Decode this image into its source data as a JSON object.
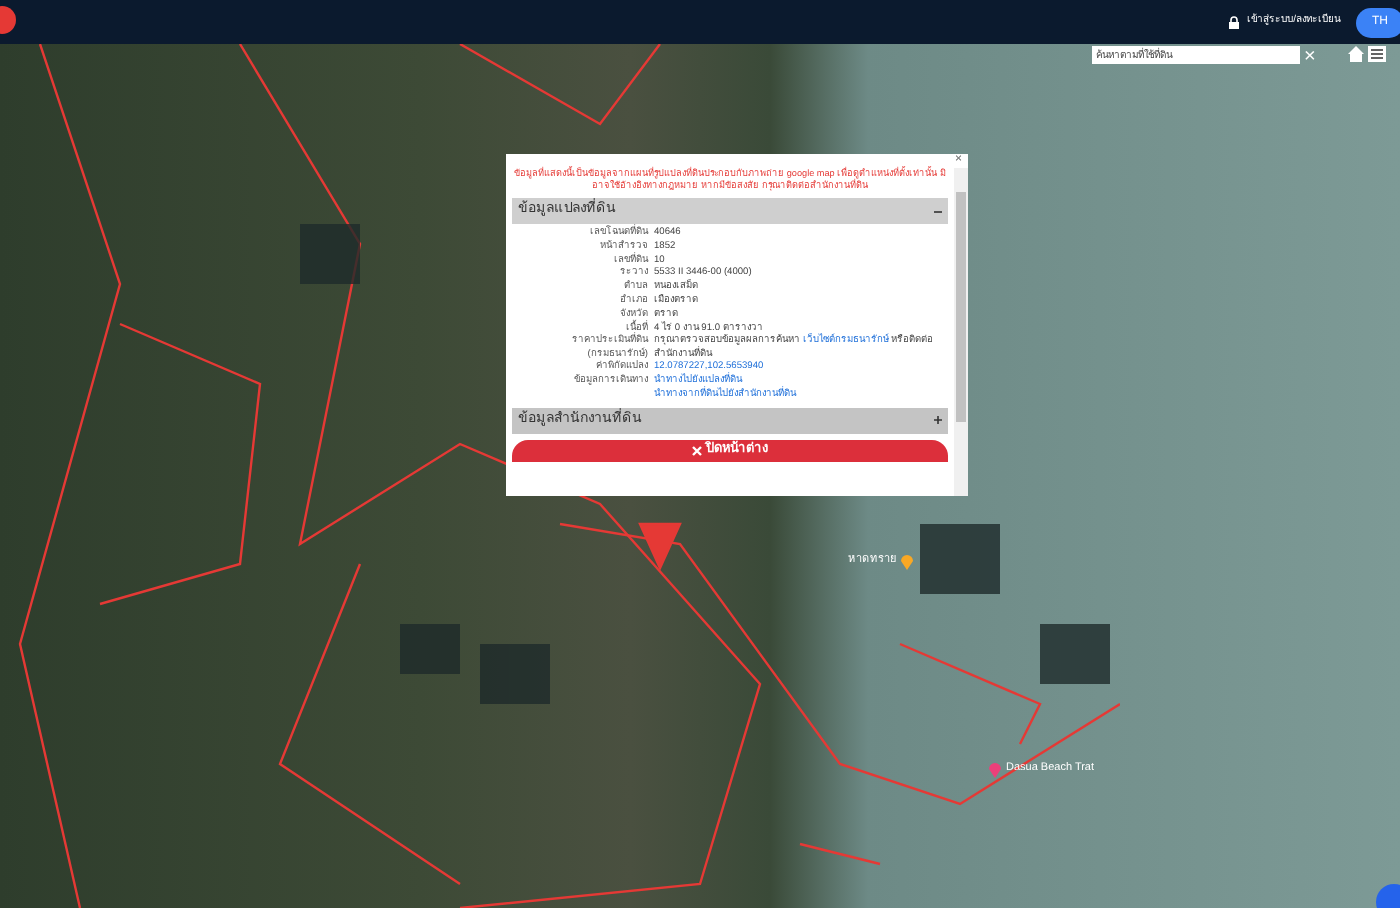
{
  "top_bar": {
    "login_link": "เข้าสู่ระบบ/ลงทะเบียน",
    "language_button": "TH"
  },
  "search": {
    "placeholder": "ค้นหาตามที่ใช้ที่ดิน",
    "clear": "×"
  },
  "map": {
    "places": [
      {
        "name": "หาดทราย"
      },
      {
        "name": "Dasua Beach Trat"
      }
    ]
  },
  "popup": {
    "close": "×",
    "notice": "ข้อมูลที่แสดงนี้เป็นข้อมูลจากแผนที่รูปแปลงที่ดินประกอบกับภาพถ่าย google map เพื่อดูตำแหน่งที่ตั้งเท่านั้น มิอาจใช้อ้างอิงทางกฎหมาย หากมีข้อสงสัย กรุณาติดต่อสำนักงานที่ดิน",
    "sections": [
      {
        "title": "ข้อมูลแปลงที่ดิน",
        "expanded": true,
        "fields": [
          {
            "kind": "text",
            "label": "เลขโฉนดที่ดิน",
            "value": "40646"
          },
          {
            "kind": "text",
            "label": "หน้าสำรวจ",
            "value": "1852"
          },
          {
            "kind": "text",
            "label": "เลขที่ดิน",
            "value": "10"
          },
          {
            "kind": "text",
            "label": "ระวาง",
            "value": "5533 II 3446-00 (4000)"
          },
          {
            "kind": "text",
            "label": "ตำบล",
            "value": "หนองเสม็ด"
          },
          {
            "kind": "text",
            "label": "อำเภอ",
            "value": "เมืองตราด"
          },
          {
            "kind": "text",
            "label": "จังหวัด",
            "value": "ตราด"
          },
          {
            "kind": "text",
            "label": "เนื้อที่",
            "value": "4 ไร่ 0 งาน 91.0 ตารางวา"
          },
          {
            "kind": "price",
            "label": "ราคาประเมินที่ดิน",
            "label_2": "(กรมธนารักษ์)",
            "value": "กรุณาตรวจสอบข้อมูลผลการค้นหา",
            "link": "เว็บไซต์กรมธนารักษ์",
            "suffix": "หรือติดต่อสำนักงานที่ดิน"
          },
          {
            "kind": "link",
            "label": "ค่าพิกัดแปลง",
            "value": "12.0787227,102.5653940"
          },
          {
            "kind": "links",
            "label": "ข้อมูลการเดินทาง",
            "values": [
              "นำทางไปยังแปลงที่ดิน",
              "นำทางจากที่ดินไปยังสำนักงานที่ดิน"
            ]
          }
        ]
      },
      {
        "title": "ข้อมูลสำนักงานที่ดิน",
        "expanded": false
      }
    ],
    "close_button": "ปิดหน้าต่าง"
  }
}
